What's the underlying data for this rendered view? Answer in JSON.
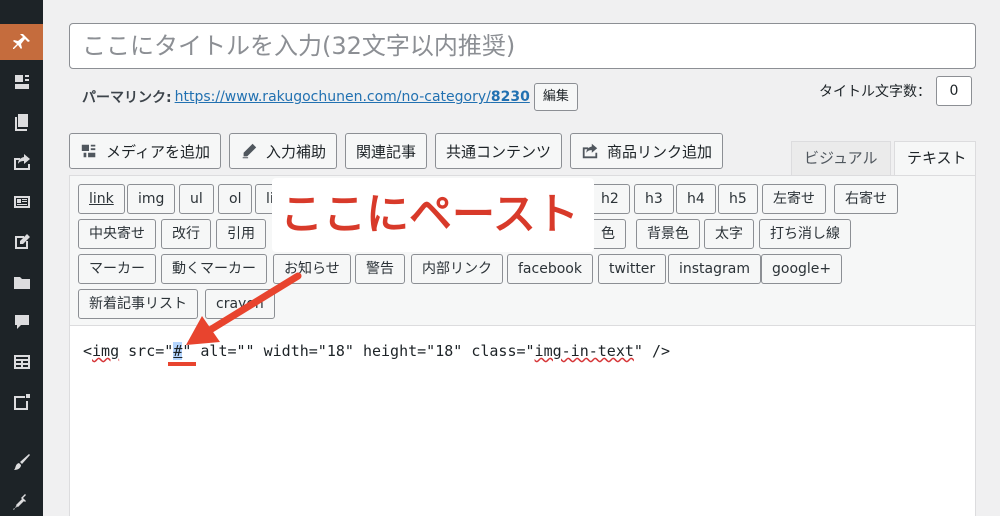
{
  "title": {
    "placeholder": "ここにタイトルを入力(32文字以内推奨)"
  },
  "permalink": {
    "label": "パーマリンク:",
    "url_base": "https://www.rakugochunen.com/no-category/",
    "slug": "8230",
    "edit_label": "編集"
  },
  "counter": {
    "label": "タイトル文字数：",
    "value": "0"
  },
  "media_buttons": [
    {
      "label": "メディアを追加",
      "icon": "media-icon"
    },
    {
      "label": "入力補助",
      "icon": "pencil-icon"
    },
    {
      "label": "関連記事",
      "icon": ""
    },
    {
      "label": "共通コンテンツ",
      "icon": ""
    },
    {
      "label": "商品リンク追加",
      "icon": "export-icon"
    }
  ],
  "tabs": {
    "visual": "ビジュアル",
    "text": "テキスト"
  },
  "quicktags": {
    "row1": [
      "link",
      "img",
      "ul",
      "ol",
      "li",
      "h2",
      "h3",
      "h4",
      "h5",
      "左寄せ",
      "右寄せ"
    ],
    "row2": [
      "中央寄せ",
      "改行",
      "引用",
      "色",
      "背景色",
      "太字",
      "打ち消し線"
    ],
    "row3": [
      "マーカー",
      "動くマーカー",
      "お知らせ",
      "警告",
      "内部リンク",
      "facebook",
      "twitter",
      "instagram",
      "google+"
    ],
    "row4": [
      "新着記事リスト",
      "crayon"
    ]
  },
  "code": {
    "pre": "<",
    "tag": "img",
    "mid": " src=\"",
    "sel": "#",
    "post1": "\" alt=\"\" width=\"18\" height=\"18\" class=\"",
    "cls": "img-in-text",
    "post2": "\" />"
  },
  "annotation": {
    "text": "ここにペースト",
    "color": "#d83a2a"
  },
  "colors": {
    "sidebar": "#1d2327",
    "sidebar_active": "#c56c3d",
    "link": "#2271b1",
    "annotation": "#d83a2a"
  }
}
